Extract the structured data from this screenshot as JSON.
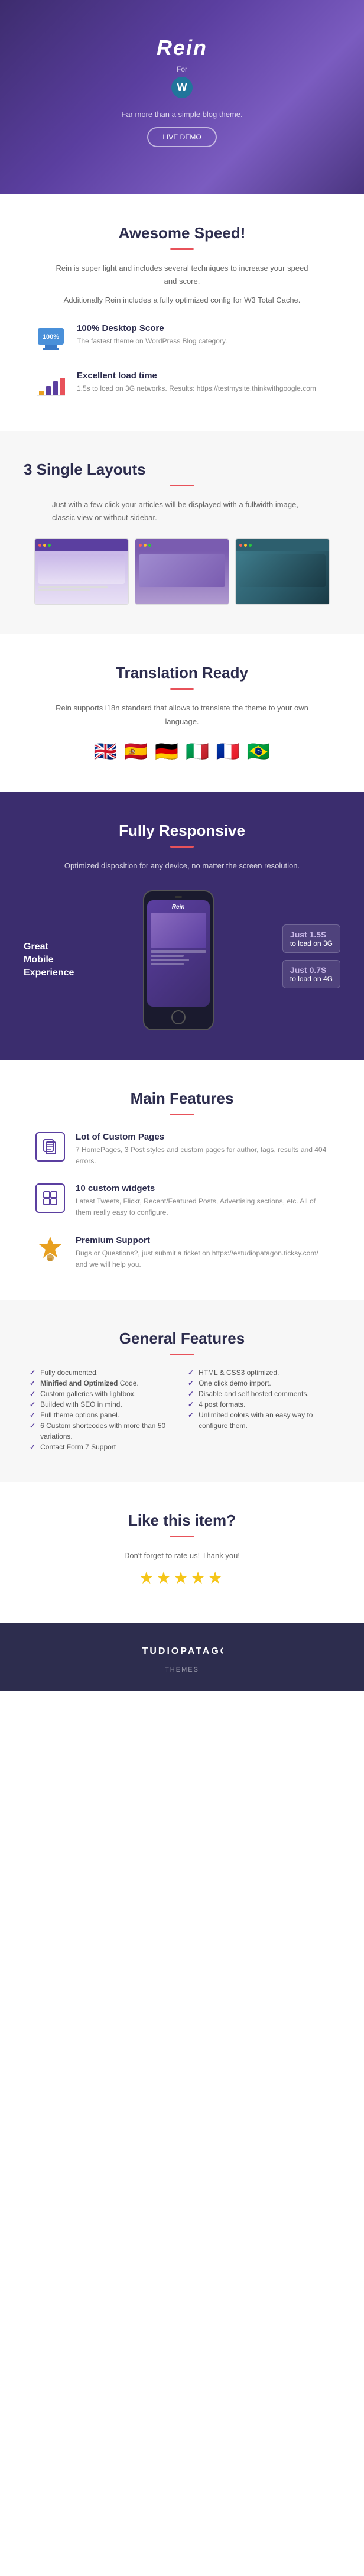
{
  "hero": {
    "logo_text": "Rein",
    "for_text": "For",
    "wp_symbol": "W",
    "tagline": "Far more than a simple blog theme.",
    "demo_btn": "LIVE DEMO",
    "bg_note": "dark purple gradient"
  },
  "speed_section": {
    "title": "Awesome Speed!",
    "description": "Rein is super light and includes several techniques to increase your speed and score.",
    "extra": "Additionally Rein includes a fully optimized config for W3 Total Cache.",
    "feature1_title": "100% Desktop Score",
    "feature1_desc": "The fastest theme on WordPress Blog category.",
    "feature2_title": "Excellent load time",
    "feature2_desc": "1.5s to load on 3G networks.\nResults: https://testmysite.thinkwithgoogle.com"
  },
  "layouts_section": {
    "title": "3 Single Layouts",
    "description": "Just with a few click your articles will be displayed with a fullwidth image, classic view or without sidebar."
  },
  "translation_section": {
    "title": "Translation Ready",
    "description": "Rein supports i18n standard that allows to translate the theme to your own language.",
    "flags": [
      "🇬🇧",
      "🇪🇸",
      "🇩🇪",
      "🇮🇹",
      "🇫🇷",
      "🇧🇷"
    ]
  },
  "responsive_section": {
    "title": "Fully Responsive",
    "description": "Optimized disposition for any device, no matter the screen resolution.",
    "mobile_label_line1": "Great",
    "mobile_label_line2": "Mobile",
    "mobile_label_line3": "Experience",
    "phone_logo": "Rein",
    "speed1_label": "Just 1.5S",
    "speed1_sub": "to load on 3G",
    "speed2_label": "Just 0.7S",
    "speed2_sub": "to load on 4G"
  },
  "main_features": {
    "title": "Main Features",
    "feature1_title": "Lot of Custom Pages",
    "feature1_desc": "7 HomePages, 3 Post styles and custom pages for author, tags, results and 404 errors.",
    "feature2_title": "10 custom widgets",
    "feature2_desc": "Latest Tweets, Flickr, Recent/Featured Posts, Advertising sections, etc. All of them really easy to configure.",
    "feature3_title": "Premium Support",
    "feature3_desc": "Bugs or Questions?, just submit a ticket on https://estudiopatagon.ticksy.com/ and we will help you."
  },
  "general_features": {
    "title": "General Features",
    "col1": [
      "Fully documented.",
      "Minified and Optimized Code.",
      "Custom galleries with lightbox.",
      "Builded with SEO in mind.",
      "Full theme options panel.",
      "6 Custom shortcodes with more than 50 variations.",
      "Contact Form 7 Support"
    ],
    "col2": [
      "HTML & CSS3 optimized.",
      "One click demo import.",
      "Disable and self hosted comments.",
      "4 post formats.",
      "Unlimited colors with an easy way to configure them."
    ]
  },
  "like_section": {
    "title": "Like this item?",
    "subtitle": "Don't forget to rate us! Thank you!",
    "stars": "★★★★★"
  },
  "footer": {
    "brand": "ESTUDIOPATAGON",
    "sub": "THEMES"
  }
}
